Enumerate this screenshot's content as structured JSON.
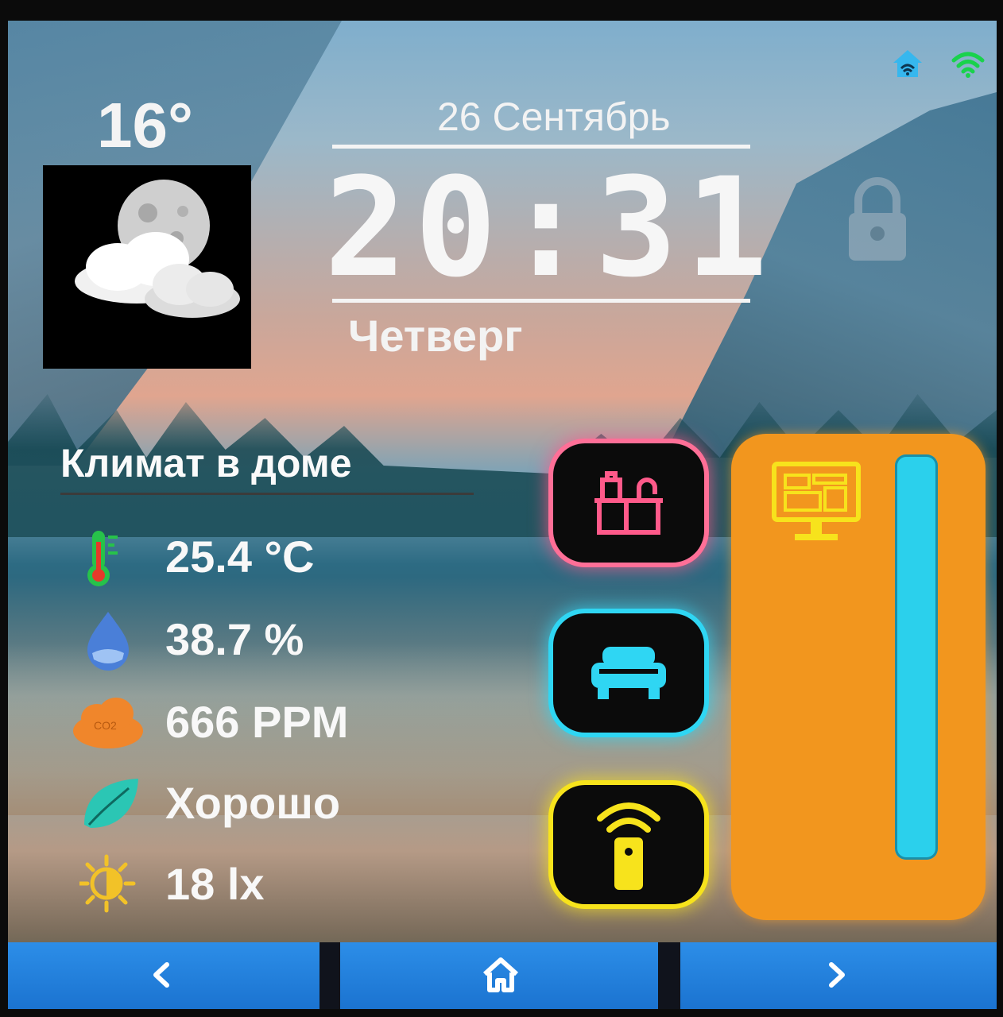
{
  "status": {
    "home_icon": "home-wifi-icon",
    "wifi_icon": "wifi-icon",
    "home_color": "#36b7ee",
    "wifi_color": "#19d24c"
  },
  "weather": {
    "temperature": "16°",
    "icon": "moon-cloud-icon"
  },
  "clock": {
    "date": "26 Сентябрь",
    "time": "20:31",
    "weekday": "Четверг"
  },
  "lock": {
    "icon": "lock-icon"
  },
  "climate": {
    "title": "Климат в доме",
    "metrics": [
      {
        "icon": "thermometer-icon",
        "value": "25.4 °C",
        "color": "#27c24a"
      },
      {
        "icon": "humidity-drop-icon",
        "value": "38.7 %",
        "color": "#4a7fd8"
      },
      {
        "icon": "co2-cloud-icon",
        "value": "666 PPM",
        "color": "#f0862b"
      },
      {
        "icon": "leaf-icon",
        "value": "Хорошо",
        "color": "#2bc6b4"
      },
      {
        "icon": "brightness-icon",
        "value": "18 lx",
        "color": "#f2c228"
      }
    ]
  },
  "modes": [
    {
      "icon": "kitchen-icon",
      "color": "#ff5a8a"
    },
    {
      "icon": "sofa-icon",
      "color": "#2fd6f3"
    },
    {
      "icon": "remote-signal-icon",
      "color": "#f7e31c"
    }
  ],
  "panel": {
    "icon": "monitor-icon",
    "color": "#f2961e",
    "icon_color": "#f7e31c",
    "slider_level": 1.0
  },
  "navbar": {
    "prev_icon": "chevron-left-icon",
    "home_icon": "home-icon",
    "next_icon": "chevron-right-icon"
  }
}
